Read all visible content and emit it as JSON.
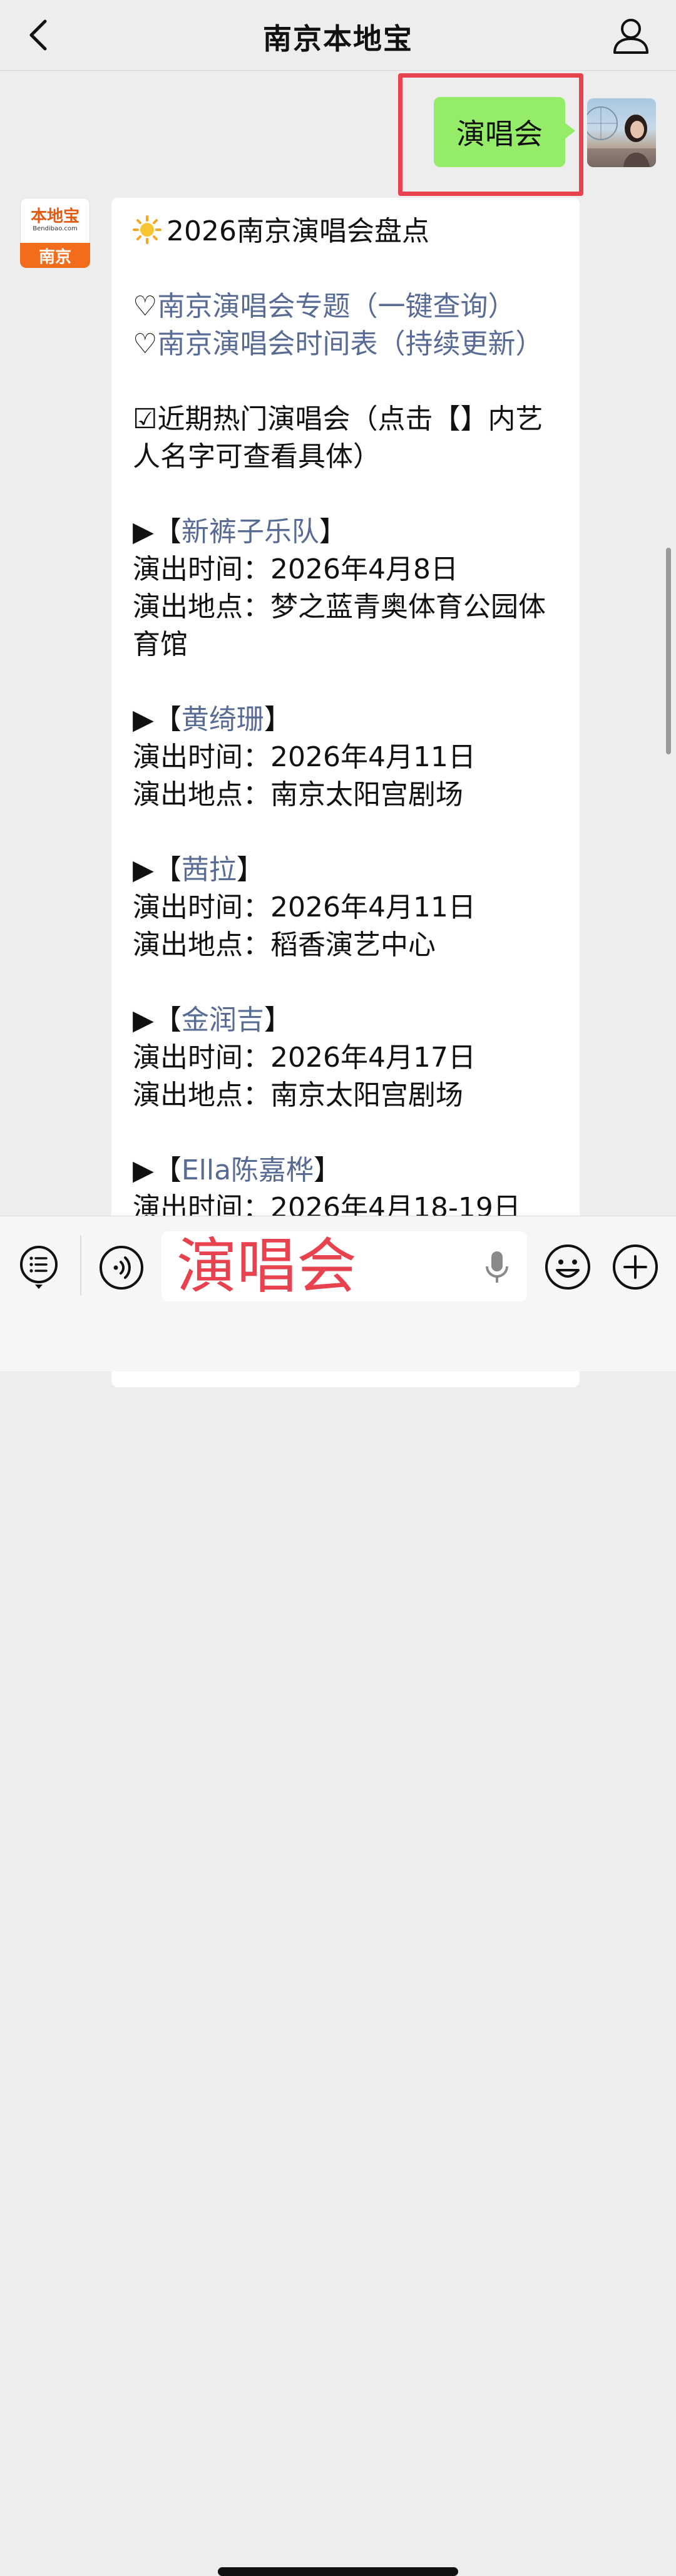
{
  "header": {
    "title": "南京本地宝"
  },
  "sent": {
    "text": "演唱会"
  },
  "bot_avatar": {
    "brand": "本地宝",
    "url": "Bendibao.com",
    "city": "南京"
  },
  "message": {
    "heading": "2026南京演唱会盘点",
    "link1_prefix": "♡",
    "link1": "南京演唱会专题（一键查询）",
    "link2_prefix": "♡",
    "link2": "南京演唱会时间表（持续更新）",
    "note": "☑近期热门演唱会（点击【】内艺人名字可查看具体）",
    "concerts": [
      {
        "artist": "新裤子乐队",
        "time_label": "演出时间：",
        "time": "2026年4月8日",
        "place_label": "演出地点：",
        "place": "梦之蓝青奥体育公园体育馆"
      },
      {
        "artist": "黄绮珊",
        "time_label": "演出时间：",
        "time": "2026年4月11日",
        "place_label": "演出地点：",
        "place": "南京太阳宫剧场"
      },
      {
        "artist": "茜拉",
        "time_label": "演出时间：",
        "time": "2026年4月11日",
        "place_label": "演出地点：",
        "place": "稻香演艺中心"
      },
      {
        "artist": "金润吉",
        "time_label": "演出时间：",
        "time": "2026年4月17日",
        "place_label": "演出地点：",
        "place": "南京太阳宫剧场"
      },
      {
        "artist": "Ella陈嘉桦",
        "time_label": "演出时间：",
        "time": "2026年4月18-19日"
      }
    ],
    "arrow": "▶【",
    "close_bracket": "】"
  },
  "input": {
    "value": "演唱会"
  },
  "colors": {
    "accent_red": "#e8424f",
    "bubble_green": "#95ec69",
    "link": "#576b95"
  }
}
